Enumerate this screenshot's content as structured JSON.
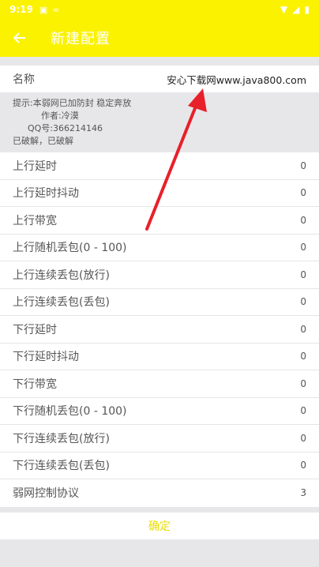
{
  "status": {
    "time": "9:19"
  },
  "header": {
    "title": "新建配置"
  },
  "name_row": {
    "label": "名称",
    "value": "安心下载网www.java800.com"
  },
  "hint": {
    "line1": "提示:本弱网已加防封 稳定奔放",
    "line2": "作者:冷漠",
    "line3": "QQ号:366214146",
    "line4": "已破解，已破解"
  },
  "settings": [
    {
      "label": "上行延时",
      "value": "0"
    },
    {
      "label": "上行延时抖动",
      "value": "0"
    },
    {
      "label": "上行带宽",
      "value": "0"
    },
    {
      "label": "上行随机丢包(0 - 100)",
      "value": "0"
    },
    {
      "label": "上行连续丢包(放行)",
      "value": "0"
    },
    {
      "label": "上行连续丢包(丢包)",
      "value": "0"
    },
    {
      "label": "下行延时",
      "value": "0"
    },
    {
      "label": "下行延时抖动",
      "value": "0"
    },
    {
      "label": "下行带宽",
      "value": "0"
    },
    {
      "label": "下行随机丢包(0 - 100)",
      "value": "0"
    },
    {
      "label": "下行连续丢包(放行)",
      "value": "0"
    },
    {
      "label": "下行连续丢包(丢包)",
      "value": "0"
    },
    {
      "label": "弱网控制协议",
      "value": "3"
    }
  ],
  "confirm_label": "确定",
  "colors": {
    "accent": "#fbf200",
    "confirm_text": "#eadf00",
    "arrow": "#e8202a"
  }
}
